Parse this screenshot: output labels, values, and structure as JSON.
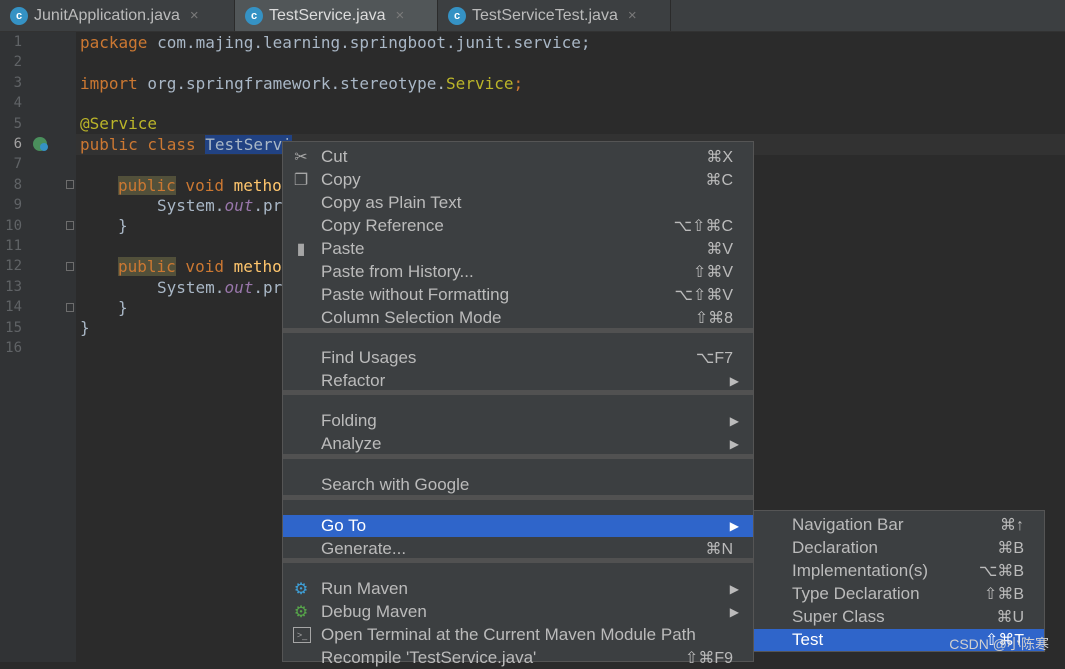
{
  "tabs": [
    {
      "name": "JunitApplication.java",
      "icon": "java-class-app-icon",
      "active": false
    },
    {
      "name": "TestService.java",
      "icon": "java-class-icon",
      "active": true
    },
    {
      "name": "TestServiceTest.java",
      "icon": "java-test-class-icon",
      "active": false
    }
  ],
  "tab_close_glyph": "×",
  "line_numbers": [
    "1",
    "2",
    "3",
    "4",
    "5",
    "6",
    "7",
    "8",
    "9",
    "10",
    "11",
    "12",
    "13",
    "14",
    "15",
    "16"
  ],
  "current_line": "6",
  "code": {
    "l1_kw": "package",
    "l1_rest": " com.majing.learning.springboot.junit.service;",
    "l3_kw": "import",
    "l3_rest": " org.springframework.stereotype.",
    "l3_cls": "Service",
    "l3_semi": ";",
    "l5": "@Service",
    "l6_kw": "public class ",
    "l6_sel": "TestServi",
    "l8_kw": "public",
    "l8_kw2": " void ",
    "l8_m": "metho",
    "l9_a": "System.",
    "l9_b": "out",
    "l9_c": ".pr",
    "l10": "}",
    "l12_kw": "public",
    "l12_kw2": " void ",
    "l12_m": "metho",
    "l13_a": "System.",
    "l13_b": "out",
    "l13_c": ".pr",
    "l14": "}",
    "l15": "}"
  },
  "context_menu": {
    "items": [
      {
        "label": "Cut",
        "shortcut": "⌘X",
        "icon": "scissors-icon"
      },
      {
        "label": "Copy",
        "shortcut": "⌘C",
        "icon": "copy-icon"
      },
      {
        "label": "Copy as Plain Text",
        "shortcut": ""
      },
      {
        "label": "Copy Reference",
        "shortcut": "⌥⇧⌘C"
      },
      {
        "label": "Paste",
        "shortcut": "⌘V",
        "icon": "paste-icon"
      },
      {
        "label": "Paste from History...",
        "shortcut": "⇧⌘V"
      },
      {
        "label": "Paste without Formatting",
        "shortcut": "⌥⇧⌘V"
      },
      {
        "label": "Column Selection Mode",
        "shortcut": "⇧⌘8"
      },
      {
        "label": "Find Usages",
        "shortcut": "⌥F7"
      },
      {
        "label": "Refactor",
        "submenu": true
      },
      {
        "label": "Folding",
        "submenu": true
      },
      {
        "label": "Analyze",
        "submenu": true
      },
      {
        "label": "Search with Google",
        "shortcut": ""
      },
      {
        "label": "Go To",
        "submenu": true,
        "highlighted": true
      },
      {
        "label": "Generate...",
        "shortcut": "⌘N"
      },
      {
        "label": "Run Maven",
        "submenu": true,
        "icon": "gear-icon"
      },
      {
        "label": "Debug Maven",
        "submenu": true,
        "icon": "debug-gear-icon"
      },
      {
        "label": "Open Terminal at the Current Maven Module Path",
        "shortcut": "",
        "icon": "terminal-icon"
      },
      {
        "label": "Recompile 'TestService.java'",
        "shortcut": "⇧⌘F9"
      }
    ],
    "submenu_arrow": "▶"
  },
  "goto_submenu": {
    "items": [
      {
        "label": "Navigation Bar",
        "shortcut": "⌘↑"
      },
      {
        "label": "Declaration",
        "shortcut": "⌘B"
      },
      {
        "label": "Implementation(s)",
        "shortcut": "⌥⌘B"
      },
      {
        "label": "Type Declaration",
        "shortcut": "⇧⌘B"
      },
      {
        "label": "Super Class",
        "shortcut": "⌘U"
      },
      {
        "label": "Test",
        "shortcut": "⇧⌘T",
        "highlighted": true
      }
    ]
  },
  "watermark": "CSDN @小陈寒",
  "colors": {
    "editor_bg": "#2b2b2b",
    "keyword": "#cc7832",
    "annotation": "#bbb529",
    "menu_bg": "#3c3f41",
    "highlight": "#2f65ca"
  }
}
